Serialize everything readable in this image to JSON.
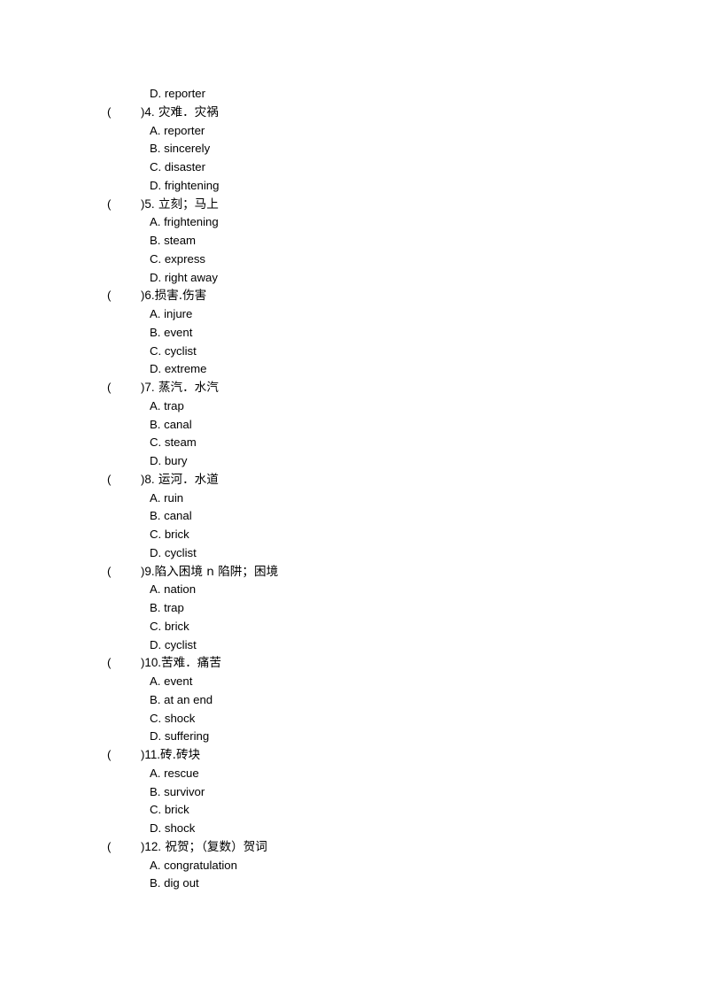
{
  "document": {
    "type": "vocabulary-matching-worksheet",
    "page_background": "#ffffff",
    "text_color": "#000000",
    "orphan_option": "D. reporter",
    "paren_open": "(",
    "paren_close": ")"
  },
  "questions": [
    {
      "number": "4.",
      "prompt": " 灾难．灾祸",
      "options": [
        "A. reporter",
        "B. sincerely",
        "C. disaster",
        "D. frightening"
      ]
    },
    {
      "number": "5.",
      "prompt": " 立刻；马上",
      "options": [
        "A. frightening",
        "B. steam",
        "C. express",
        "D. right away"
      ]
    },
    {
      "number": "6.",
      "prompt": "损害.伤害",
      "options": [
        "A. injure",
        "B. event",
        "C. cyclist",
        "D. extreme"
      ]
    },
    {
      "number": "7.",
      "prompt": " 蒸汽．水汽",
      "options": [
        "A. trap",
        "B. canal",
        "C. steam",
        "D. bury"
      ]
    },
    {
      "number": "8.",
      "prompt": " 运河．水道",
      "options": [
        "A. ruin",
        "B. canal",
        "C. brick",
        "D. cyclist"
      ]
    },
    {
      "number": "9.",
      "prompt": "陷入困境 n 陷阱；困境",
      "options": [
        "A. nation",
        "B. trap",
        "C. brick",
        "D. cyclist"
      ]
    },
    {
      "number": "10.",
      "prompt": "苦难．痛苦",
      "options": [
        "A. event",
        "B. at an end",
        "C. shock",
        "D. suffering"
      ]
    },
    {
      "number": "11.",
      "prompt": "砖.砖块",
      "options": [
        "A. rescue",
        "B. survivor",
        "C. brick",
        "D. shock"
      ]
    },
    {
      "number": "12.",
      "prompt": " 祝贺；（复数）贺词",
      "options": [
        "A. congratulation",
        "B. dig out"
      ]
    }
  ]
}
